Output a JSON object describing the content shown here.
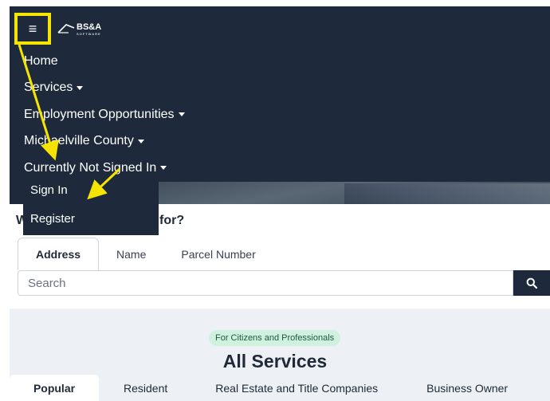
{
  "brand": {
    "logo_text": "BS&A",
    "logo_subtext": "SOFTWARE"
  },
  "menu_button": {
    "icon": "hamburger-menu-icon",
    "glyph": "≡"
  },
  "nav": {
    "items": [
      {
        "label": "Home",
        "has_caret": false
      },
      {
        "label": "Services",
        "has_caret": true
      },
      {
        "label": "Employment Opportunities",
        "has_caret": true
      },
      {
        "label": "Michaelville County",
        "has_caret": true
      },
      {
        "label": "Currently Not Signed In",
        "has_caret": true
      }
    ]
  },
  "account_dropdown": {
    "items": [
      {
        "label": "Sign In"
      },
      {
        "label": "Register"
      }
    ]
  },
  "search": {
    "heading_start": "W",
    "heading_end": "for?",
    "tabs": [
      {
        "label": "Address",
        "active": true
      },
      {
        "label": "Name",
        "active": false
      },
      {
        "label": "Parcel Number",
        "active": false
      }
    ],
    "placeholder": "Search",
    "button_icon": "search-icon"
  },
  "services": {
    "badge": "For Citizens and Professionals",
    "title": "All Services",
    "tabs": [
      {
        "label": "Popular",
        "active": true
      },
      {
        "label": "Resident",
        "active": false
      },
      {
        "label": "Real Estate and Title Companies",
        "active": false
      },
      {
        "label": "Business Owner",
        "active": false
      }
    ]
  },
  "colors": {
    "navbar": "#1e2a3b",
    "highlight": "#f4e400",
    "badge_bg": "#cff1de",
    "badge_text": "#1e5b3a",
    "section_bg": "#edf1f5"
  }
}
